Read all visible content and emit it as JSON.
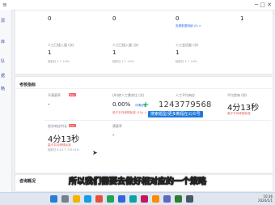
{
  "sidebar": {
    "items": [
      "源",
      "库",
      "队",
      "据",
      "略"
    ]
  },
  "top_panel": {
    "row1": [
      {
        "value": "0"
      },
      {
        "value": "0"
      },
      {
        "value": "0",
        "link": "查看数据明细 (0) >"
      },
      {
        "value": "1"
      }
    ],
    "row2": [
      {
        "label": "人工已接入量 (次)",
        "value": "1",
        "sub": "较前日 1  ↑ +0%"
      },
      {
        "label": "人工已接入量 (次)",
        "value": "1",
        "sub": "较前日 1  ↑ +0%"
      },
      {
        "label": "人工会话量 (次)",
        "value": "1",
        "sub": "较前日 1  ↑ +0%"
      }
    ]
  },
  "perf": {
    "title": "考核指标",
    "metrics": [
      {
        "label": "不满意率",
        "badge": "New",
        "value": "-",
        "sub": ""
      },
      {
        "label": "(AI)转人工需求比 (次)",
        "value": "0.00%",
        "link": "详情设置",
        "red": "低于平均考核标准 (1%)  ↓ -1%"
      },
      {
        "label": "人工平均响应",
        "value": "",
        "sub": ""
      },
      {
        "label": "平均首响 (秒)",
        "value": "4分13秒",
        "red": "高于平均考核标准"
      },
      {
        "label": "首次响应时长",
        "badge": "New",
        "value": "4分13秒",
        "red": "高于平均考核标准",
        "sub": "较前日 4:13  ↑ 770.41%"
      },
      {
        "label": "满意率",
        "value": "-",
        "sub": ""
      }
    ]
  },
  "section3": {
    "title": "咨询概况"
  },
  "watermark": {
    "number": "1243779568",
    "tag": "搜索题型/更多教程在公众号"
  },
  "subtitle": "所以我们需要去做好相对应的一个策略",
  "window_controls": "─   □   ✕",
  "tray": {
    "time": "10:36",
    "date": "2024/1/1"
  }
}
